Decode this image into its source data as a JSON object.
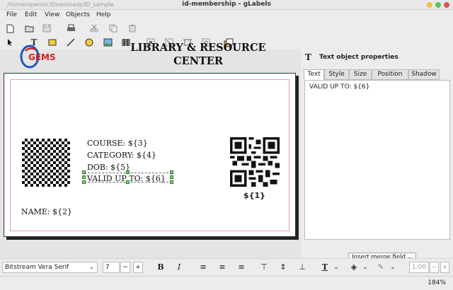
{
  "window": {
    "path": "/home/opensrc/Downloads/ID_sample",
    "title": "id-membership - gLabels"
  },
  "menu": {
    "file": "File",
    "edit": "Edit",
    "view": "View",
    "objects": "Objects",
    "help": "Help"
  },
  "label": {
    "title": "LIBRARY & RESOURCE CENTER",
    "logo_text": "GEMS",
    "course": "COURSE: ${3}",
    "category": "CATEGORY: ${4}",
    "dob": "DOB: ${5}",
    "valid": "VALID UP TO: ${6}",
    "name": "NAME: ${2}",
    "qr_field": "${1}"
  },
  "panel": {
    "title": "Text object properties",
    "tabs": [
      "Text",
      "Style",
      "Size",
      "Position",
      "Shadow"
    ],
    "text_content": "VALID UP TO: ${6}",
    "merge_button": "Insert merge field"
  },
  "fontbar": {
    "font_family": "Bitstream Vera Serif",
    "font_size": "7",
    "line_spacing": "1.00"
  },
  "status": {
    "zoom": "184%"
  },
  "colors": {
    "accent": "#2b5fb8",
    "logo_red": "#d42020",
    "logo_blue": "#1e55c8",
    "selection_handle": "#7ecf7e"
  }
}
